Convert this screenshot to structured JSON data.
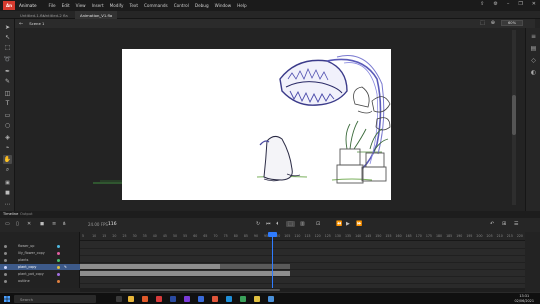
{
  "app": {
    "logo": "An",
    "name": "Animate"
  },
  "menu": [
    "File",
    "Edit",
    "View",
    "Insert",
    "Modify",
    "Text",
    "Commands",
    "Control",
    "Debug",
    "Window",
    "Help"
  ],
  "window_controls": [
    "–",
    "❐",
    "✕"
  ],
  "doc_tabs": [
    {
      "label": "Untitled-1.fla",
      "active": false
    },
    {
      "label": "Untitled-2 fla",
      "active": false
    },
    {
      "label": "Animation_V1.fla",
      "active": true
    }
  ],
  "scene": {
    "label": "Scene 1",
    "zoom": "60%"
  },
  "timeline": {
    "tabs": [
      "Timeline",
      "Output"
    ],
    "fps": "24.00 FPS",
    "current_frame": "116",
    "frame_numbers": [
      "5",
      "10",
      "15",
      "20",
      "25",
      "30",
      "35",
      "40",
      "45",
      "50",
      "55",
      "60",
      "65",
      "70",
      "75",
      "80",
      "85",
      "90",
      "95",
      "100",
      "105",
      "110",
      "115",
      "120",
      "125",
      "130",
      "135",
      "140",
      "145",
      "150",
      "155",
      "160",
      "165",
      "170",
      "175",
      "180",
      "185",
      "190",
      "195",
      "200",
      "205",
      "210",
      "215",
      "220"
    ],
    "layers": [
      {
        "name": "flower_up",
        "color": "#4fb8e0",
        "selected": false
      },
      {
        "name": "lily_flower_copy",
        "color": "#e05fa0",
        "selected": false
      },
      {
        "name": "plants",
        "color": "#48c070",
        "selected": false
      },
      {
        "name": "plant_copy",
        "color": "#e0c040",
        "selected": true
      },
      {
        "name": "plant_pot_copy",
        "color": "#a070e0",
        "selected": false
      },
      {
        "name": "outline",
        "color": "#e08040",
        "selected": false
      }
    ]
  },
  "taskbar": {
    "search_placeholder": "Search",
    "time": "13:31",
    "date": "02/06/2021"
  }
}
